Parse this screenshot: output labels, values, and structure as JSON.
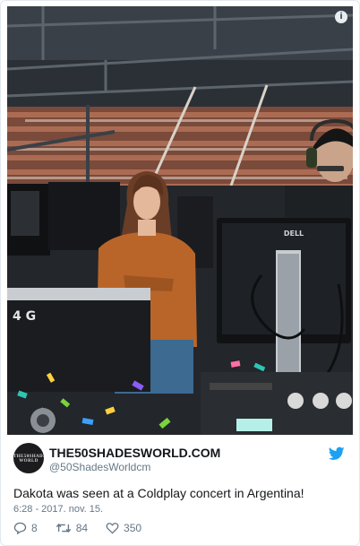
{
  "tweet": {
    "display_name": "THE50SHADESWORLD.COM",
    "handle": "@50ShadesWorldcm",
    "avatar_text": "THE50SHADES WORLD",
    "text": "Dakota was seen at a Coldplay concert in Argentina!",
    "timestamp": "6:28 - 2017. nov. 15.",
    "media_info_glyph": "i",
    "monitor_brand": "DELL",
    "case_label": "4 G"
  },
  "actions": {
    "replies": "8",
    "retweets": "84",
    "likes": "350"
  },
  "icons": [
    "info-icon",
    "twitter-bird-icon",
    "reply-icon",
    "retweet-icon",
    "like-heart-icon"
  ],
  "colors": {
    "brand_blue": "#1da1f2",
    "text": "#14171a",
    "secondary_text": "#657786",
    "border": "#e1e8ed"
  }
}
